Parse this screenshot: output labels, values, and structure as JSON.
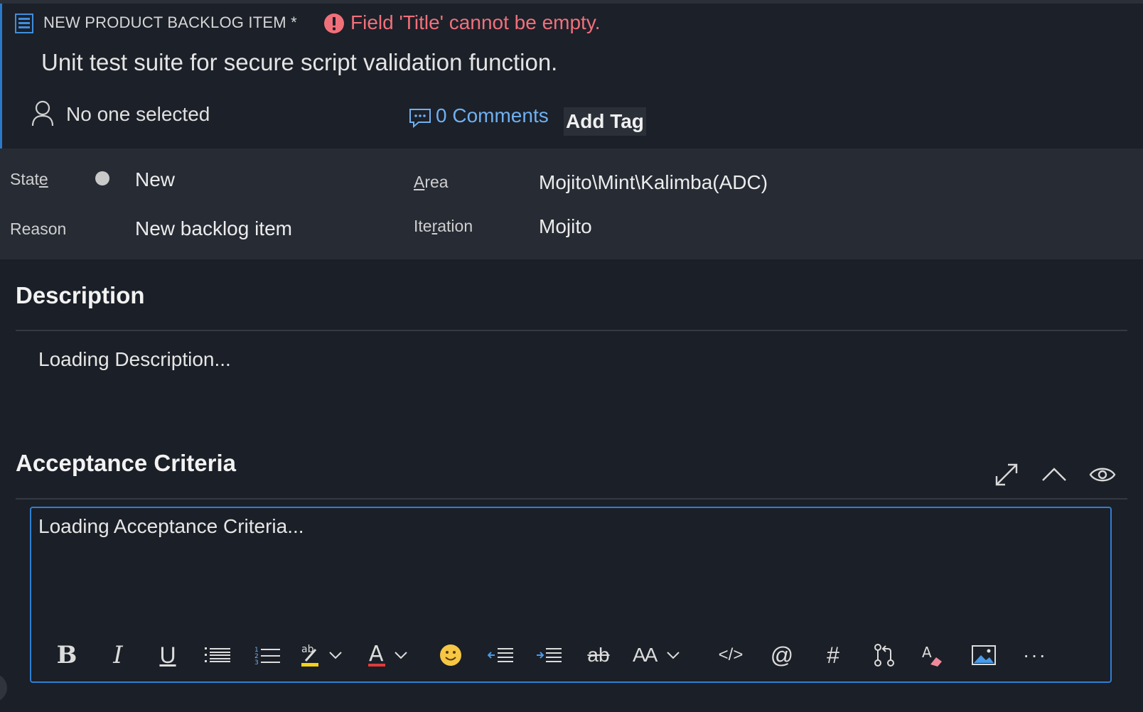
{
  "header": {
    "type_label": "NEW PRODUCT BACKLOG ITEM *",
    "error": "Field 'Title' cannot be empty.",
    "title": "Unit test suite for secure script validation function.",
    "assignee": "No one selected",
    "comments": "0 Comments",
    "add_tag": "Add Tag"
  },
  "fields": {
    "state_label_pre": "Stat",
    "state_label_key": "e",
    "state_value": "New",
    "reason_label": "Reason",
    "reason_value": "New backlog item",
    "area_label_key": "A",
    "area_label_post": "rea",
    "area_value": "Mojito\\Mint\\Kalimba(ADC)",
    "iteration_label_pre": "Ite",
    "iteration_label_key": "r",
    "iteration_label_post": "ation",
    "iteration_value": "Mojito"
  },
  "description": {
    "title": "Description",
    "loading": "Loading Description..."
  },
  "acceptance": {
    "title": "Acceptance Criteria",
    "loading": "Loading Acceptance Criteria..."
  },
  "icons": {
    "type": "backlog-item-icon",
    "error": "error-circle-icon",
    "person": "person-icon",
    "comment": "comment-icon",
    "expand": "expand-icon",
    "collapse": "chevron-up-icon",
    "preview": "eye-icon"
  },
  "toolbar": {
    "bold": "B",
    "italic": "I",
    "underline": "U",
    "font_color_glyph": "A",
    "text_size_glyph": "AA",
    "strike_glyph": "ab",
    "highlight_glyph": "ab",
    "spell_glyph": "A",
    "mention": "@",
    "hashtag": "#",
    "code": "</>",
    "more": "···"
  },
  "colors": {
    "accent": "#2b79c9",
    "error": "#f0707a",
    "link": "#6fb0f0",
    "background": "#1b1f27",
    "fields_band": "#262b34"
  }
}
